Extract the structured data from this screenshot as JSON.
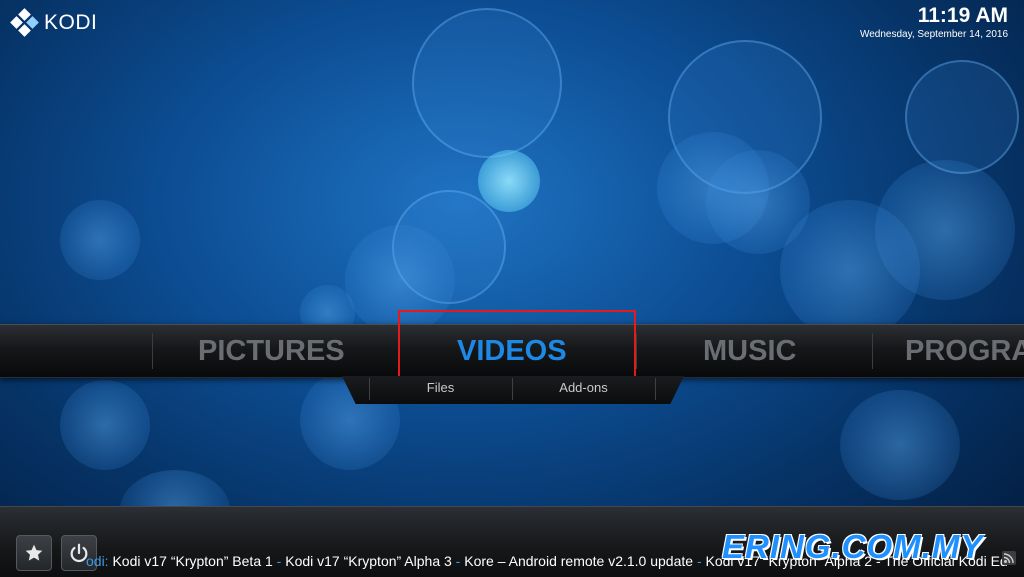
{
  "app": {
    "name": "KODI"
  },
  "clock": {
    "time": "11:19 AM",
    "date": "Wednesday, September 14, 2016"
  },
  "menu": {
    "items": [
      {
        "label": "PICTURES",
        "active": false
      },
      {
        "label": "VIDEOS",
        "active": true
      },
      {
        "label": "MUSIC",
        "active": false
      },
      {
        "label": "PROGRA",
        "active": false
      }
    ]
  },
  "submenu": {
    "items": [
      "Files",
      "Add-ons"
    ]
  },
  "footer": {
    "favourites_icon": "star-icon",
    "power_icon": "power-icon",
    "ticker": {
      "source": "odi:",
      "items": [
        "Kodi v17 “Krypton” Beta 1",
        "Kodi v17 “Krypton” Alpha 3",
        "Kore – Android remote v2.1.0 update",
        "Kodi v17 “Krypton” Alpha 2 - The Official Kodi Ed"
      ],
      "separator": "-"
    },
    "rss_icon": "rss-icon"
  },
  "watermark": "ERING.COM.MY",
  "colors": {
    "accent": "#1e88e5",
    "highlight": "#e31b1b",
    "inactive": "#6a6d72"
  }
}
